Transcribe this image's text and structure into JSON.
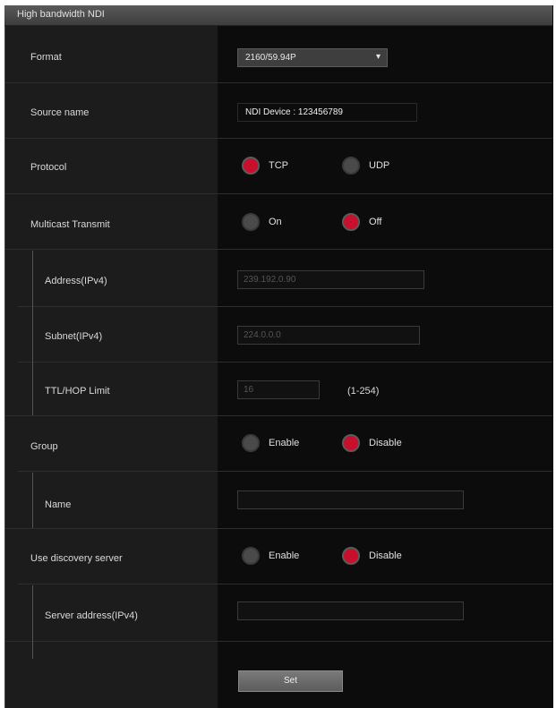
{
  "window": {
    "title": "High bandwidth NDI"
  },
  "fields": {
    "format": {
      "label": "Format",
      "value": "2160/59.94P"
    },
    "source_name": {
      "label": "Source name",
      "value": "NDI Device : 123456789"
    },
    "protocol": {
      "label": "Protocol",
      "options": [
        "TCP",
        "UDP"
      ],
      "selected": "TCP"
    },
    "multicast": {
      "label": "Multicast Transmit",
      "options": [
        "On",
        "Off"
      ],
      "selected": "Off"
    },
    "address": {
      "label": "Address(IPv4)",
      "value": "239.192.0.90"
    },
    "subnet": {
      "label": "Subnet(IPv4)",
      "value": "224.0.0.0"
    },
    "ttl": {
      "label": "TTL/HOP Limit",
      "value": "16",
      "range": "(1-254)"
    },
    "group": {
      "label": "Group",
      "options": [
        "Enable",
        "Disable"
      ],
      "selected": "Disable"
    },
    "name": {
      "label": "Name",
      "value": ""
    },
    "discovery": {
      "label": "Use discovery server",
      "options": [
        "Enable",
        "Disable"
      ],
      "selected": "Disable"
    },
    "server_address": {
      "label": "Server address(IPv4)",
      "value": ""
    }
  },
  "buttons": {
    "set": "Set"
  },
  "colors": {
    "accent": "#c8102e",
    "panel": "#0b0b0b",
    "label_col": "#1c1c1c"
  }
}
